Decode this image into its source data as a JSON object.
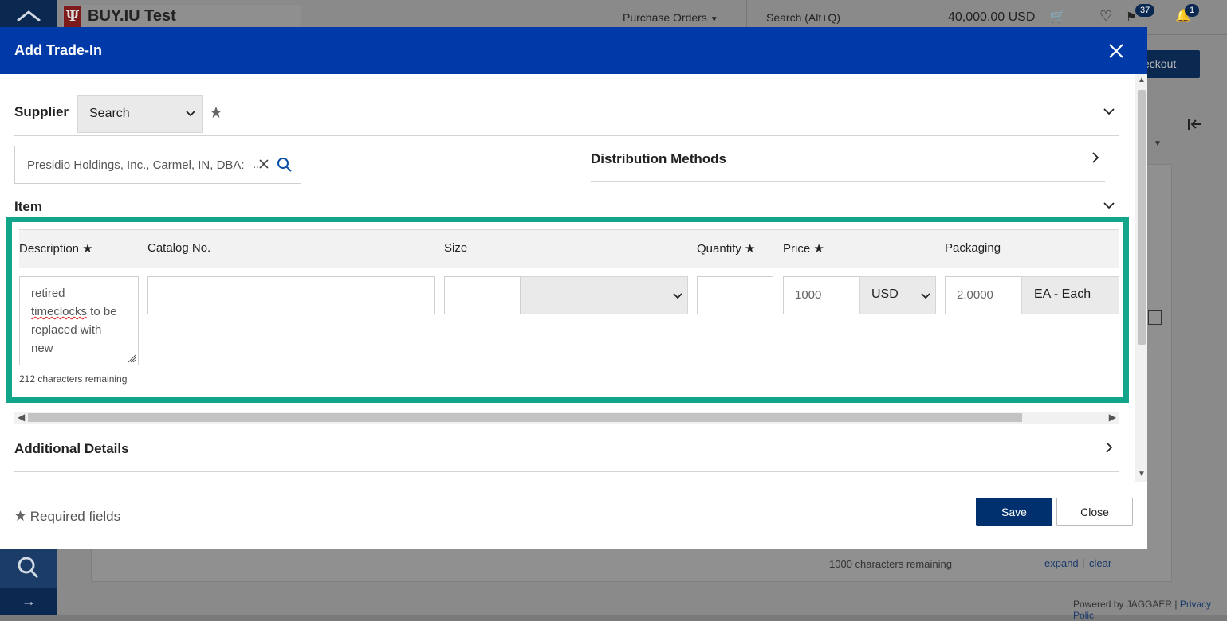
{
  "background": {
    "app_name": "BUY.IU Test",
    "logo_mark": "Ψ",
    "nav_purchase_orders": "Purchase Orders",
    "search_placeholder": "Search (Alt+Q)",
    "cart_total": "40,000.00 USD",
    "flag_badge": "37",
    "bell_badge": "1",
    "checkout_label": "eckout",
    "chars_remaining": "1000 characters remaining",
    "expand_link": "expand",
    "clear_link": "clear",
    "link_separator": "|",
    "powered_by": "Powered by JAGGAER | ",
    "privacy_link": "Privacy Polic",
    "sidebar_arrow": "→"
  },
  "modal": {
    "title": "Add Trade-In",
    "supplier": {
      "label": "Supplier",
      "search_select_value": "Search",
      "selected_value": "Presidio Holdings, Inc., Carmel, IN, DBA:",
      "ellipsis": ".."
    },
    "distribution_methods_label": "Distribution Methods",
    "item": {
      "label": "Item",
      "columns": {
        "description": "Description ★",
        "catalog_no": "Catalog No.",
        "size": "Size",
        "quantity": "Quantity ★",
        "price": "Price ★",
        "packaging": "Packaging"
      },
      "description_value": {
        "line1": "retired",
        "line2a": "timeclocks",
        "line2b": " to be",
        "line3": "replaced with",
        "line4": "new"
      },
      "chars_remaining": "212 characters remaining",
      "catalog_no_value": "",
      "size_value": "",
      "size_unit_value": "",
      "quantity_value": "",
      "price_value": "1000",
      "currency_value": "USD",
      "packaging_value": "2.0000",
      "packaging_unit_value": "EA - Each"
    },
    "additional_details_label": "Additional Details",
    "footer": {
      "required_text": "Required fields",
      "save_label": "Save",
      "close_label": "Close"
    }
  },
  "colors": {
    "header_blue": "#003aa8",
    "highlight_teal": "#11a68a",
    "save_navy": "#00306e"
  },
  "icons": [
    "home-icon",
    "cart-icon",
    "heart-icon",
    "flag-icon",
    "bell-icon",
    "search-icon",
    "close-icon",
    "star-icon",
    "chevron-down-icon",
    "chevron-right-icon",
    "collapse-left-icon"
  ]
}
